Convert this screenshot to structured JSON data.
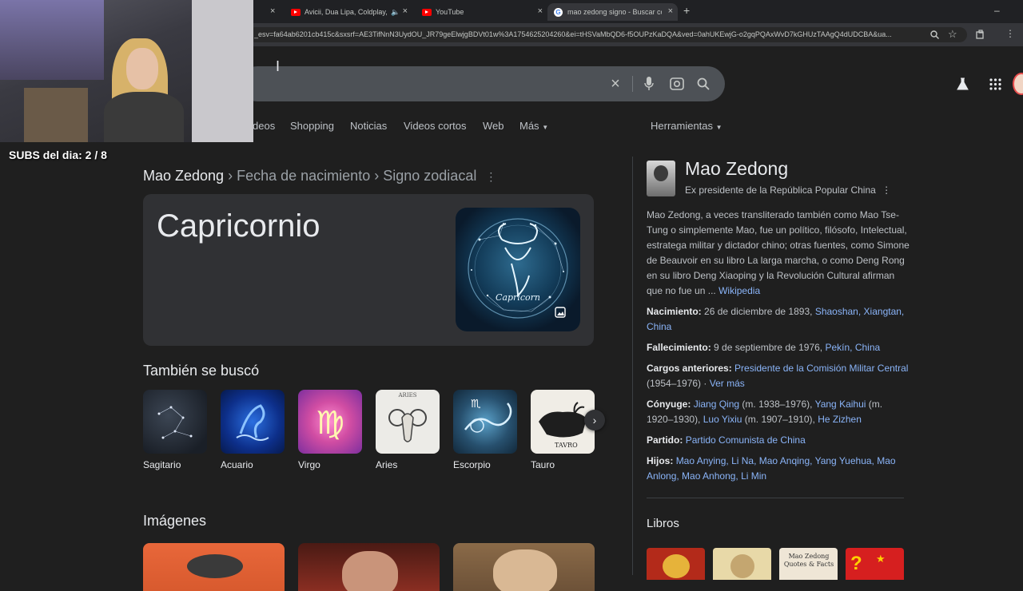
{
  "browser": {
    "tabs": [
      {
        "title": "Avicii, Dua Lipa, Coldplay, M",
        "type": "youtube",
        "audio": true
      },
      {
        "title": "YouTube",
        "type": "youtube"
      },
      {
        "title": "mao zedong signo - Buscar co",
        "type": "google",
        "active": true
      }
    ],
    "new_tab": "+",
    "close": "×",
    "url": "_esv=fa64ab6201cb415c&sxsrf=AE3TifNnN3UydOU_JR79geElwjgBDVt01w%3A1754625204260&ei=tHSVaMbQD6-f5OUPzKaDQA&ved=0ahUKEwjG-o2gqPQAxWvD7kGHUzTAAgQ4dUDCBA&ua..."
  },
  "overlay": {
    "subs_text": "SUBS del dia: 2 / 8"
  },
  "search": {
    "nav_tabs": [
      "deos",
      "Shopping",
      "Noticias",
      "Videos cortos",
      "Web",
      "Más"
    ],
    "tools": "Herramientas"
  },
  "answer": {
    "breadcrumb_entity": "Mao Zedong",
    "breadcrumb_1": "Fecha de nacimiento",
    "breadcrumb_2": "Signo zodiacal",
    "value": "Capricornio",
    "image_caption": "Capricorn"
  },
  "related": {
    "heading": "También se buscó",
    "items": [
      {
        "label": "Sagitario"
      },
      {
        "label": "Acuario"
      },
      {
        "label": "Virgo"
      },
      {
        "label": "Aries",
        "image_text": "ARIES"
      },
      {
        "label": "Escorpio"
      },
      {
        "label": "Tauro",
        "image_text": "TAVRO"
      }
    ]
  },
  "images_heading": "Imágenes",
  "knowledge_panel": {
    "title": "Mao Zedong",
    "subtitle": "Ex presidente de la República Popular China",
    "description": "Mao Zedong, a veces transliterado también como Mao Tse-Tung o simplemente Mao, fue un político, filósofo, Intelectual, estratega militar y dictador chino; otras fuentes, como Simone de Beauvoir en su libro La larga marcha, o como Deng Rong en su libro Deng Xiaoping y la Revolución Cultural afirman que no fue un ...",
    "source": "Wikipedia",
    "birth_label": "Nacimiento:",
    "birth_value": "26 de diciembre de 1893,",
    "birth_place_1": "Shaoshan,",
    "birth_place_2": "Xiangtan, China",
    "death_label": "Fallecimiento:",
    "death_value": "9 de septiembre de 1976,",
    "death_place": "Pekín, China",
    "offices_label": "Cargos anteriores:",
    "offices_link": "Presidente de la Comisión Militar Central",
    "offices_years": "(1954–1976) ·",
    "offices_more": "Ver más",
    "spouse_label": "Cónyuge:",
    "spouse_1": "Jiang Qing",
    "spouse_1_years": "(m. 1938–1976),",
    "spouse_2": "Yang Kaihui",
    "spouse_2_years": "(m. 1920–1930),",
    "spouse_3": "Luo Yixiu",
    "spouse_3_years": "(m. 1907–1910),",
    "spouse_4": "He Zizhen",
    "party_label": "Partido:",
    "party_value": "Partido Comunista de China",
    "children_label": "Hijos:",
    "children_value": "Mao Anying, Li Na, Mao Anqing, Yang Yuehua, Mao Anlong, Mao Anhong, Li Min",
    "books_heading": "Libros",
    "book_text": "Mao Zedong Quotes & Facts"
  }
}
